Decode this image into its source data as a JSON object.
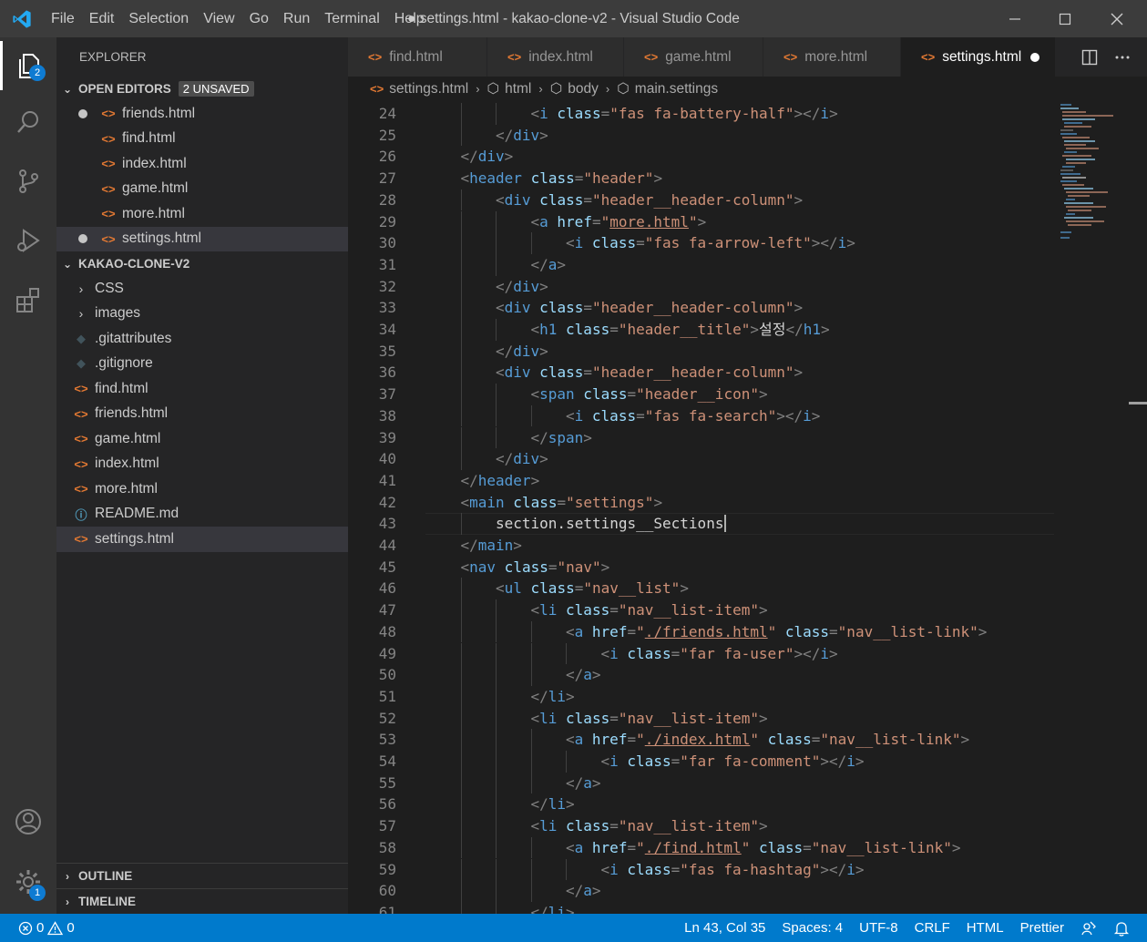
{
  "app": {
    "window_title": "● settings.html - kakao-clone-v2 - Visual Studio Code",
    "menu": [
      "File",
      "Edit",
      "Selection",
      "View",
      "Go",
      "Run",
      "Terminal",
      "Help"
    ]
  },
  "activity_bar": {
    "explorer_badge": "2",
    "manage_badge": "1",
    "icons": [
      "explorer-icon",
      "search-icon",
      "source-control-icon",
      "run-debug-icon",
      "extensions-icon",
      "account-icon",
      "gear-icon"
    ]
  },
  "sidebar": {
    "title": "EXPLORER",
    "open_editors": {
      "label": "OPEN EDITORS",
      "badge": "2 UNSAVED",
      "files": [
        {
          "name": "friends.html",
          "unsaved": true
        },
        {
          "name": "find.html",
          "unsaved": false
        },
        {
          "name": "index.html",
          "unsaved": false
        },
        {
          "name": "game.html",
          "unsaved": false
        },
        {
          "name": "more.html",
          "unsaved": false
        },
        {
          "name": "settings.html",
          "unsaved": true
        }
      ]
    },
    "project": {
      "label": "KAKAO-CLONE-V2",
      "items": [
        {
          "name": "CSS",
          "kind": "folder"
        },
        {
          "name": "images",
          "kind": "folder"
        },
        {
          "name": ".gitattributes",
          "kind": "git"
        },
        {
          "name": ".gitignore",
          "kind": "git"
        },
        {
          "name": "find.html",
          "kind": "html"
        },
        {
          "name": "friends.html",
          "kind": "html"
        },
        {
          "name": "game.html",
          "kind": "html"
        },
        {
          "name": "index.html",
          "kind": "html"
        },
        {
          "name": "more.html",
          "kind": "html"
        },
        {
          "name": "README.md",
          "kind": "info"
        },
        {
          "name": "settings.html",
          "kind": "html"
        }
      ]
    },
    "outline_label": "OUTLINE",
    "timeline_label": "TIMELINE"
  },
  "tabs": [
    {
      "label": "find.html"
    },
    {
      "label": "index.html"
    },
    {
      "label": "game.html"
    },
    {
      "label": "more.html"
    },
    {
      "label": "settings.html",
      "active": true,
      "unsaved": true
    }
  ],
  "breadcrumb": [
    "settings.html",
    "html",
    "body",
    "main.settings"
  ],
  "editor": {
    "current_line": 43,
    "lines": [
      {
        "n": "24",
        "indent": 3,
        "tokens": [
          [
            "p",
            "<"
          ],
          [
            "t",
            "i"
          ],
          [
            "a",
            " class"
          ],
          [
            "p",
            "="
          ],
          [
            "s",
            "\"fas fa-battery-half\""
          ],
          [
            "p",
            "></"
          ],
          [
            "t",
            "i"
          ],
          [
            "p",
            ">"
          ]
        ]
      },
      {
        "n": "25",
        "indent": 2,
        "tokens": [
          [
            "p",
            "</"
          ],
          [
            "t",
            "div"
          ],
          [
            "p",
            ">"
          ]
        ]
      },
      {
        "n": "26",
        "indent": 1,
        "tokens": [
          [
            "p",
            "</"
          ],
          [
            "t",
            "div"
          ],
          [
            "p",
            ">"
          ]
        ]
      },
      {
        "n": "27",
        "indent": 1,
        "tokens": [
          [
            "p",
            "<"
          ],
          [
            "t",
            "header"
          ],
          [
            "a",
            " class"
          ],
          [
            "p",
            "="
          ],
          [
            "s",
            "\"header\""
          ],
          [
            "p",
            ">"
          ]
        ]
      },
      {
        "n": "28",
        "indent": 2,
        "tokens": [
          [
            "p",
            "<"
          ],
          [
            "t",
            "div"
          ],
          [
            "a",
            " class"
          ],
          [
            "p",
            "="
          ],
          [
            "s",
            "\"header__header-column\""
          ],
          [
            "p",
            ">"
          ]
        ]
      },
      {
        "n": "29",
        "indent": 3,
        "tokens": [
          [
            "p",
            "<"
          ],
          [
            "t",
            "a"
          ],
          [
            "a",
            " href"
          ],
          [
            "p",
            "="
          ],
          [
            "s",
            "\""
          ],
          [
            "u",
            "more.html"
          ],
          [
            "s",
            "\""
          ],
          [
            "p",
            ">"
          ]
        ]
      },
      {
        "n": "30",
        "indent": 4,
        "tokens": [
          [
            "p",
            "<"
          ],
          [
            "t",
            "i"
          ],
          [
            "a",
            " class"
          ],
          [
            "p",
            "="
          ],
          [
            "s",
            "\"fas fa-arrow-left\""
          ],
          [
            "p",
            "></"
          ],
          [
            "t",
            "i"
          ],
          [
            "p",
            ">"
          ]
        ]
      },
      {
        "n": "31",
        "indent": 3,
        "tokens": [
          [
            "p",
            "</"
          ],
          [
            "t",
            "a"
          ],
          [
            "p",
            ">"
          ]
        ]
      },
      {
        "n": "32",
        "indent": 2,
        "tokens": [
          [
            "p",
            "</"
          ],
          [
            "t",
            "div"
          ],
          [
            "p",
            ">"
          ]
        ]
      },
      {
        "n": "33",
        "indent": 2,
        "tokens": [
          [
            "p",
            "<"
          ],
          [
            "t",
            "div"
          ],
          [
            "a",
            " class"
          ],
          [
            "p",
            "="
          ],
          [
            "s",
            "\"header__header-column\""
          ],
          [
            "p",
            ">"
          ]
        ]
      },
      {
        "n": "34",
        "indent": 3,
        "tokens": [
          [
            "p",
            "<"
          ],
          [
            "t",
            "h1"
          ],
          [
            "a",
            " class"
          ],
          [
            "p",
            "="
          ],
          [
            "s",
            "\"header__title\""
          ],
          [
            "p",
            ">"
          ],
          [
            "x",
            "설정"
          ],
          [
            "p",
            "</"
          ],
          [
            "t",
            "h1"
          ],
          [
            "p",
            ">"
          ]
        ]
      },
      {
        "n": "35",
        "indent": 2,
        "tokens": [
          [
            "p",
            "</"
          ],
          [
            "t",
            "div"
          ],
          [
            "p",
            ">"
          ]
        ]
      },
      {
        "n": "36",
        "indent": 2,
        "tokens": [
          [
            "p",
            "<"
          ],
          [
            "t",
            "div"
          ],
          [
            "a",
            " class"
          ],
          [
            "p",
            "="
          ],
          [
            "s",
            "\"header__header-column\""
          ],
          [
            "p",
            ">"
          ]
        ]
      },
      {
        "n": "37",
        "indent": 3,
        "tokens": [
          [
            "p",
            "<"
          ],
          [
            "t",
            "span"
          ],
          [
            "a",
            " class"
          ],
          [
            "p",
            "="
          ],
          [
            "s",
            "\"header__icon\""
          ],
          [
            "p",
            ">"
          ]
        ]
      },
      {
        "n": "38",
        "indent": 4,
        "tokens": [
          [
            "p",
            "<"
          ],
          [
            "t",
            "i"
          ],
          [
            "a",
            " class"
          ],
          [
            "p",
            "="
          ],
          [
            "s",
            "\"fas fa-search\""
          ],
          [
            "p",
            "></"
          ],
          [
            "t",
            "i"
          ],
          [
            "p",
            ">"
          ]
        ]
      },
      {
        "n": "39",
        "indent": 3,
        "tokens": [
          [
            "p",
            "</"
          ],
          [
            "t",
            "span"
          ],
          [
            "p",
            ">"
          ]
        ]
      },
      {
        "n": "40",
        "indent": 2,
        "tokens": [
          [
            "p",
            "</"
          ],
          [
            "t",
            "div"
          ],
          [
            "p",
            ">"
          ]
        ]
      },
      {
        "n": "41",
        "indent": 1,
        "tokens": [
          [
            "p",
            "</"
          ],
          [
            "t",
            "header"
          ],
          [
            "p",
            ">"
          ]
        ]
      },
      {
        "n": "42",
        "indent": 1,
        "tokens": [
          [
            "p",
            "<"
          ],
          [
            "t",
            "main"
          ],
          [
            "a",
            " class"
          ],
          [
            "p",
            "="
          ],
          [
            "s",
            "\"settings\""
          ],
          [
            "p",
            ">"
          ]
        ]
      },
      {
        "n": "43",
        "indent": 2,
        "tokens": [
          [
            "x",
            "section.settings__Sections"
          ]
        ]
      },
      {
        "n": "44",
        "indent": 1,
        "tokens": [
          [
            "p",
            "</"
          ],
          [
            "t",
            "main"
          ],
          [
            "p",
            ">"
          ]
        ]
      },
      {
        "n": "45",
        "indent": 1,
        "tokens": [
          [
            "p",
            "<"
          ],
          [
            "t",
            "nav"
          ],
          [
            "a",
            " class"
          ],
          [
            "p",
            "="
          ],
          [
            "s",
            "\"nav\""
          ],
          [
            "p",
            ">"
          ]
        ]
      },
      {
        "n": "46",
        "indent": 2,
        "tokens": [
          [
            "p",
            "<"
          ],
          [
            "t",
            "ul"
          ],
          [
            "a",
            " class"
          ],
          [
            "p",
            "="
          ],
          [
            "s",
            "\"nav__list\""
          ],
          [
            "p",
            ">"
          ]
        ]
      },
      {
        "n": "47",
        "indent": 3,
        "tokens": [
          [
            "p",
            "<"
          ],
          [
            "t",
            "li"
          ],
          [
            "a",
            " class"
          ],
          [
            "p",
            "="
          ],
          [
            "s",
            "\"nav__list-item\""
          ],
          [
            "p",
            ">"
          ]
        ]
      },
      {
        "n": "48",
        "indent": 4,
        "tokens": [
          [
            "p",
            "<"
          ],
          [
            "t",
            "a"
          ],
          [
            "a",
            " href"
          ],
          [
            "p",
            "="
          ],
          [
            "s",
            "\""
          ],
          [
            "u",
            "./friends.html"
          ],
          [
            "s",
            "\""
          ],
          [
            "a",
            " class"
          ],
          [
            "p",
            "="
          ],
          [
            "s",
            "\"nav__list-link\""
          ],
          [
            "p",
            ">"
          ]
        ]
      },
      {
        "n": "49",
        "indent": 5,
        "tokens": [
          [
            "p",
            "<"
          ],
          [
            "t",
            "i"
          ],
          [
            "a",
            " class"
          ],
          [
            "p",
            "="
          ],
          [
            "s",
            "\"far fa-user\""
          ],
          [
            "p",
            "></"
          ],
          [
            "t",
            "i"
          ],
          [
            "p",
            ">"
          ]
        ]
      },
      {
        "n": "50",
        "indent": 4,
        "tokens": [
          [
            "p",
            "</"
          ],
          [
            "t",
            "a"
          ],
          [
            "p",
            ">"
          ]
        ]
      },
      {
        "n": "51",
        "indent": 3,
        "tokens": [
          [
            "p",
            "</"
          ],
          [
            "t",
            "li"
          ],
          [
            "p",
            ">"
          ]
        ]
      },
      {
        "n": "52",
        "indent": 3,
        "tokens": [
          [
            "p",
            "<"
          ],
          [
            "t",
            "li"
          ],
          [
            "a",
            " class"
          ],
          [
            "p",
            "="
          ],
          [
            "s",
            "\"nav__list-item\""
          ],
          [
            "p",
            ">"
          ]
        ]
      },
      {
        "n": "53",
        "indent": 4,
        "tokens": [
          [
            "p",
            "<"
          ],
          [
            "t",
            "a"
          ],
          [
            "a",
            " href"
          ],
          [
            "p",
            "="
          ],
          [
            "s",
            "\""
          ],
          [
            "u",
            "./index.html"
          ],
          [
            "s",
            "\""
          ],
          [
            "a",
            " class"
          ],
          [
            "p",
            "="
          ],
          [
            "s",
            "\"nav__list-link\""
          ],
          [
            "p",
            ">"
          ]
        ]
      },
      {
        "n": "54",
        "indent": 5,
        "tokens": [
          [
            "p",
            "<"
          ],
          [
            "t",
            "i"
          ],
          [
            "a",
            " class"
          ],
          [
            "p",
            "="
          ],
          [
            "s",
            "\"far fa-comment\""
          ],
          [
            "p",
            "></"
          ],
          [
            "t",
            "i"
          ],
          [
            "p",
            ">"
          ]
        ]
      },
      {
        "n": "55",
        "indent": 4,
        "tokens": [
          [
            "p",
            "</"
          ],
          [
            "t",
            "a"
          ],
          [
            "p",
            ">"
          ]
        ]
      },
      {
        "n": "56",
        "indent": 3,
        "tokens": [
          [
            "p",
            "</"
          ],
          [
            "t",
            "li"
          ],
          [
            "p",
            ">"
          ]
        ]
      },
      {
        "n": "57",
        "indent": 3,
        "tokens": [
          [
            "p",
            "<"
          ],
          [
            "t",
            "li"
          ],
          [
            "a",
            " class"
          ],
          [
            "p",
            "="
          ],
          [
            "s",
            "\"nav__list-item\""
          ],
          [
            "p",
            ">"
          ]
        ]
      },
      {
        "n": "58",
        "indent": 4,
        "tokens": [
          [
            "p",
            "<"
          ],
          [
            "t",
            "a"
          ],
          [
            "a",
            " href"
          ],
          [
            "p",
            "="
          ],
          [
            "s",
            "\""
          ],
          [
            "u",
            "./find.html"
          ],
          [
            "s",
            "\""
          ],
          [
            "a",
            " class"
          ],
          [
            "p",
            "="
          ],
          [
            "s",
            "\"nav__list-link\""
          ],
          [
            "p",
            ">"
          ]
        ]
      },
      {
        "n": "59",
        "indent": 5,
        "tokens": [
          [
            "p",
            "<"
          ],
          [
            "t",
            "i"
          ],
          [
            "a",
            " class"
          ],
          [
            "p",
            "="
          ],
          [
            "s",
            "\"fas fa-hashtag\""
          ],
          [
            "p",
            "></"
          ],
          [
            "t",
            "i"
          ],
          [
            "p",
            ">"
          ]
        ]
      },
      {
        "n": "60",
        "indent": 4,
        "tokens": [
          [
            "p",
            "</"
          ],
          [
            "t",
            "a"
          ],
          [
            "p",
            ">"
          ]
        ]
      },
      {
        "n": "61",
        "indent": 3,
        "tokens": [
          [
            "p",
            "</"
          ],
          [
            "t",
            "li"
          ],
          [
            "p",
            ">"
          ]
        ]
      }
    ]
  },
  "status": {
    "errors": "0",
    "warnings": "0",
    "position": "Ln 43, Col 35",
    "spaces": "Spaces: 4",
    "encoding": "UTF-8",
    "eol": "CRLF",
    "language": "HTML",
    "formatter": "Prettier"
  },
  "colors": {
    "accent": "#007acc",
    "titlebar": "#3c3c3c",
    "activity_bar": "#333333",
    "sidebar": "#252526",
    "editor_bg": "#1e1e1e",
    "html_icon": "#e37933"
  }
}
